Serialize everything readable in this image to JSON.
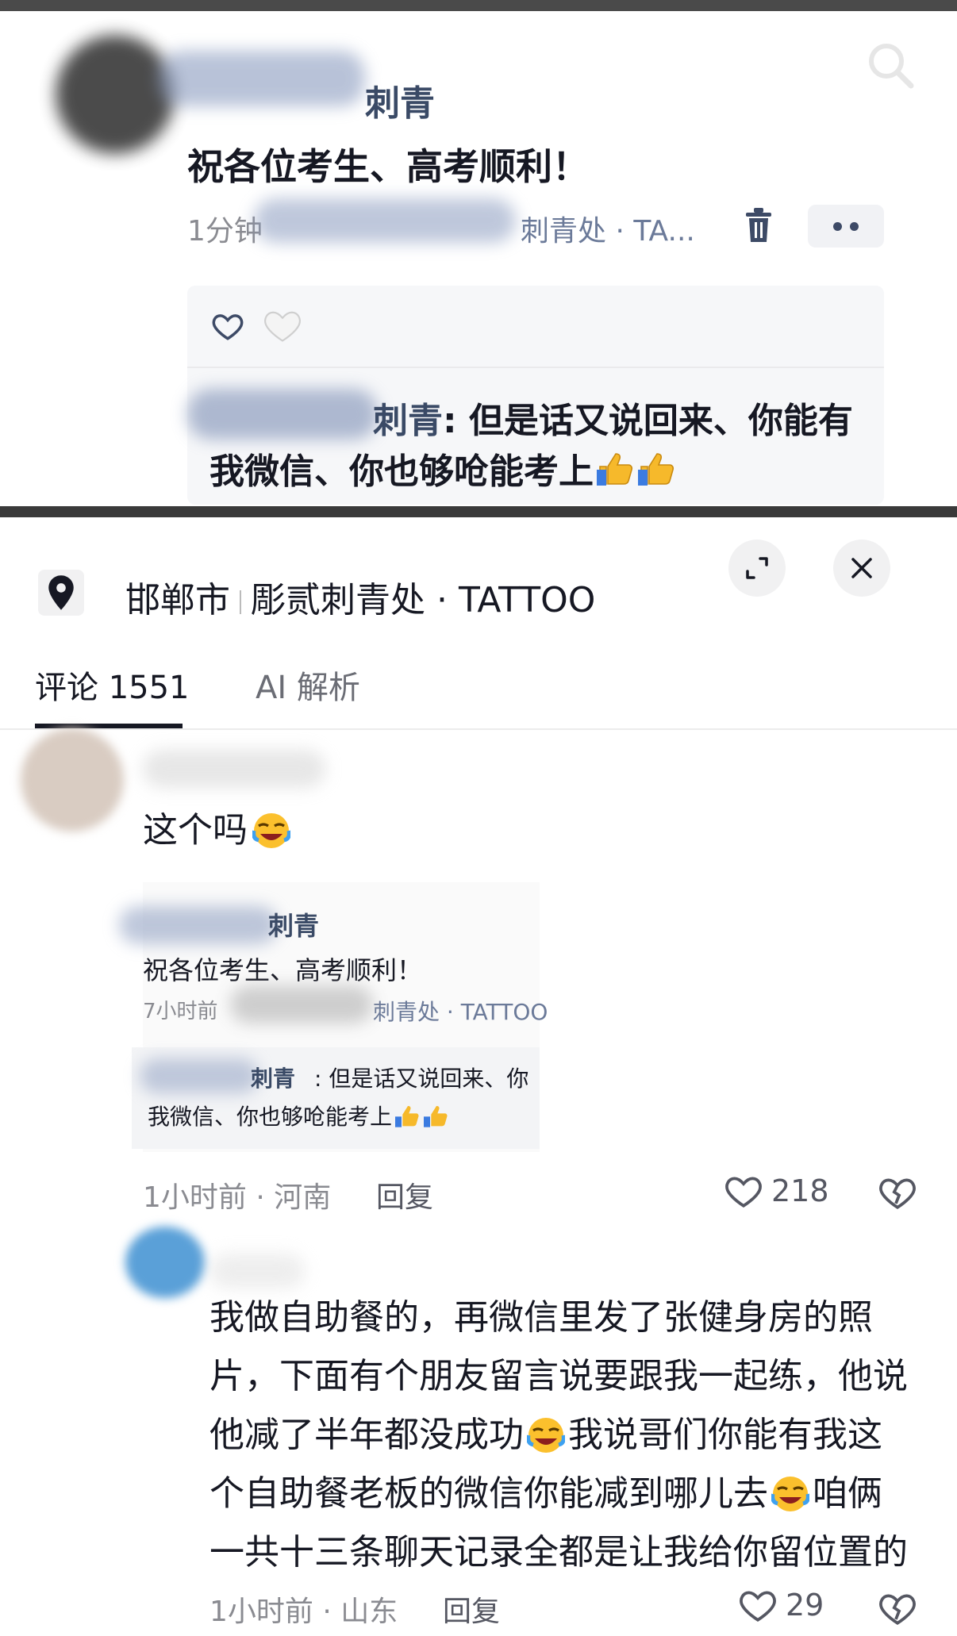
{
  "post": {
    "author_suffix": "刺青",
    "text": "祝各位考生、高考顺利！",
    "meta_prefix": "1分钟",
    "meta_location": "刺青处 · TA...",
    "reply_author_suffix": "刺青",
    "reply_line1": ": 但是话又说回来、你能有",
    "reply_line2": "我微信、你也够呛能考上"
  },
  "sheet": {
    "location_city": "邯郸市",
    "location_name": "彫贰刺青处 · TATTOO",
    "tabs": [
      {
        "label": "评论 1551"
      },
      {
        "label": "AI 解析"
      }
    ]
  },
  "comments": [
    {
      "text": "这个吗",
      "quote": {
        "author_suffix": "刺青",
        "text": "祝各位考生、高考顺利！",
        "meta_prefix": "7小时前",
        "meta_location": "刺青处 · TATTOO",
        "reply_author_suffix": "刺青",
        "reply_line1": ": 但是话又说回来、你",
        "reply_line2": "我微信、你也够呛能考上"
      },
      "meta": "1小时前 · 河南",
      "reply_label": "回复",
      "likes": "218"
    },
    {
      "lines": [
        "我做自助餐的，再微信里发了张健身房的照",
        "片，下面有个朋友留言说要跟我一起练，他说",
        "他减了半年都没成功",
        "我说哥们你能有我这",
        "个自助餐老板的微信你能减到哪儿去",
        "咱俩",
        "一共十三条聊天记录全都是让我给你留位置的"
      ],
      "meta": "1小时前 · 山东",
      "reply_label": "回复",
      "likes": "29"
    }
  ]
}
